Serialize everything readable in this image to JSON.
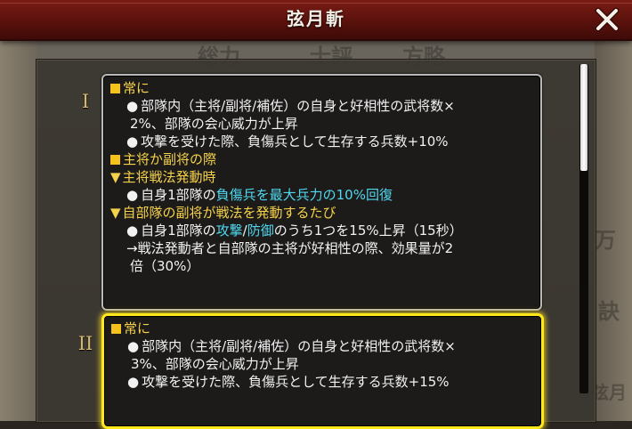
{
  "dialog": {
    "title": "弦月斬"
  },
  "background_ghost_text": [
    "総力",
    "士評",
    "方略",
    "万",
    "訣",
    "弦月"
  ],
  "levels": [
    {
      "mark": "I",
      "selected": false,
      "lines": [
        {
          "type": "header",
          "text": "常に"
        },
        {
          "type": "item",
          "text": "部隊内（主将/副将/補佐）の自身と好相性の武将数×"
        },
        {
          "type": "cont",
          "text": "2%、部隊の会心威力が上昇"
        },
        {
          "type": "item",
          "text": "攻撃を受けた際、負傷兵として生存する兵数+10%"
        },
        {
          "type": "header",
          "text": "主将か副将の際"
        },
        {
          "type": "sub",
          "text": "主将戦法発動時"
        },
        {
          "type": "item_hl",
          "pre": "自身1部隊の",
          "hl": "負傷兵を最大兵力の10%回復",
          "post": ""
        },
        {
          "type": "sub",
          "text": "自部隊の副将が戦法を発動するたび"
        },
        {
          "type": "item_hl2",
          "pre": "自身1部隊の",
          "hl1": "攻撃",
          "mid": "/",
          "hl2": "防御",
          "post": "のうち1つを15%上昇（15秒）"
        },
        {
          "type": "plain",
          "text": "→戦法発動者と自部隊の主将が好相性の際、効果量が2"
        },
        {
          "type": "cont",
          "text": "倍（30%）"
        }
      ]
    },
    {
      "mark": "II",
      "selected": true,
      "lines": [
        {
          "type": "header",
          "text": "常に"
        },
        {
          "type": "item",
          "text": "部隊内（主将/副将/補佐）の自身と好相性の武将数×"
        },
        {
          "type": "cont",
          "text": "3%、部隊の会心威力が上昇"
        },
        {
          "type": "item",
          "text": "攻撃を受けた際、負傷兵として生存する兵数+15%"
        }
      ]
    }
  ],
  "colors": {
    "title_bar": "#5a110c",
    "header_text": "#f5d24a",
    "highlight_text": "#4fd8f0",
    "selected_border": "#ffe81a"
  },
  "icons": {
    "close": "close-x-icon",
    "bullet_square": "yellow-square-icon",
    "bullet_triangle": "down-triangle-icon",
    "bullet_dot": "circle-bullet-icon"
  }
}
